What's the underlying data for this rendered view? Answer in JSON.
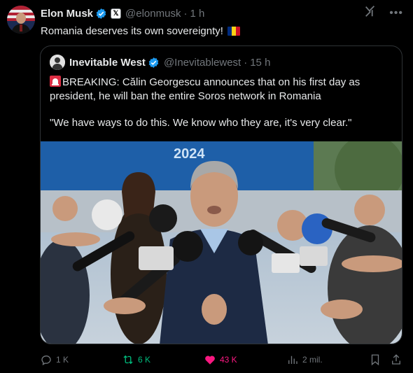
{
  "author": {
    "name": "Elon Musk",
    "handle": "@elonmusk",
    "separator": "·",
    "time": "1 h",
    "affiliate_badge": "𝕏"
  },
  "post_text": "Romania deserves its own sovereignty!",
  "flag": {
    "colors": [
      "#002b7f",
      "#fcd116",
      "#ce1126"
    ]
  },
  "quote": {
    "name": "Inevitable West",
    "handle": "@Inevitablewest",
    "separator": "·",
    "time": "15 h",
    "paragraph1": "BREAKING: Călin Georgescu announces that on his first day as president, he will ban the entire Soros network in Romania",
    "paragraph2": "\"We have ways to do this. We know who they are, it's very clear.\"",
    "photo_banner": "2024"
  },
  "actions": {
    "replies": "1 K",
    "reposts": "6 K",
    "likes": "43 K",
    "views": "2 mil."
  },
  "colors": {
    "verified": "#1d9bf0",
    "repost_active": "#00ba7c",
    "like_active": "#f91880",
    "muted": "#71767b"
  }
}
